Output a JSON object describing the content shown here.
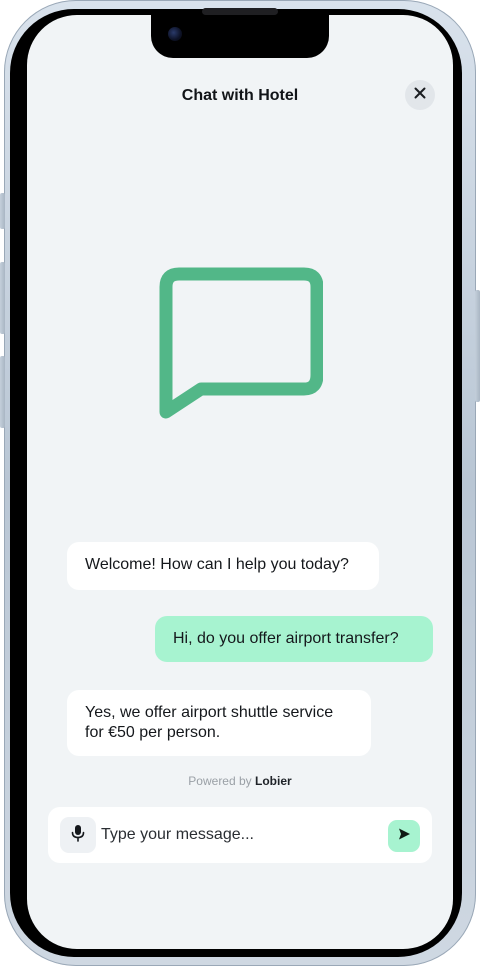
{
  "header": {
    "title": "Chat with Hotel",
    "close_icon": "close-icon"
  },
  "hero": {
    "icon": "chat-bubble-icon",
    "icon_color": "#52b788"
  },
  "messages": [
    {
      "sender": "hotel",
      "text": "Welcome! How can I help you today?"
    },
    {
      "sender": "user",
      "text": "Hi, do you offer airport transfer?"
    },
    {
      "sender": "hotel",
      "text": "Yes, we offer airport shuttle service for €50 per person."
    }
  ],
  "footer": {
    "powered_prefix": "Powered by",
    "powered_brand": "Lobier"
  },
  "composer": {
    "placeholder": "Type your message...",
    "mic_icon": "microphone-icon",
    "send_icon": "send-icon"
  },
  "colors": {
    "accent": "#a7f3d0",
    "brand_green": "#52b788",
    "screen_bg": "#f1f4f6"
  }
}
